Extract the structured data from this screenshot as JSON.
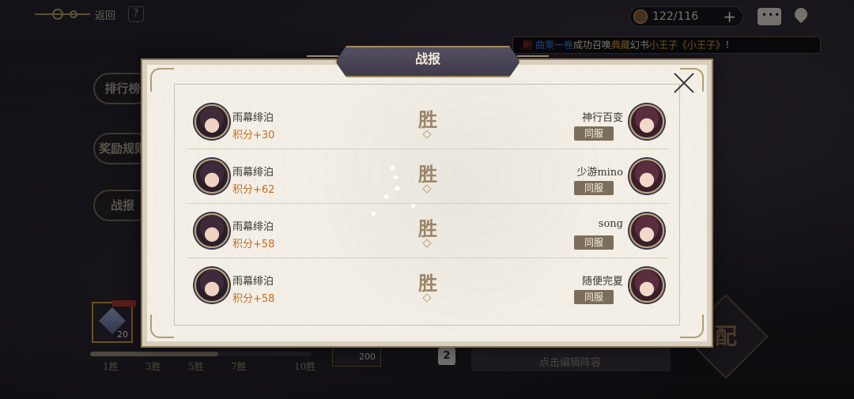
{
  "topbar": {
    "back_label": "返回",
    "help_label": "?",
    "stamina": "122/116",
    "plus_label": "+"
  },
  "marquee": {
    "seg1": "刷",
    "seg2": "曲栗一卷",
    "seg3": "成功召唤",
    "seg4": "典藏",
    "seg5": "幻书",
    "seg6": "小王子《小王子》",
    "seg7": "！"
  },
  "side": {
    "rank": "排行榜",
    "rules": "奖励规则",
    "report": "战报"
  },
  "bottom": {
    "reward_count": "20",
    "progress": 0.58,
    "milestones": [
      "1胜",
      "3胜",
      "5胜",
      "7胜",
      "10胜"
    ],
    "coin": "200",
    "chip": "2",
    "team_hint": "点击编辑阵容",
    "match_label": "配"
  },
  "modal": {
    "title": "战报",
    "rows": [
      {
        "player": "雨幕绯泊",
        "score": "积分+30",
        "result": "胜",
        "opponent": "神行百变",
        "badge": "同服"
      },
      {
        "player": "雨幕绯泊",
        "score": "积分+62",
        "result": "胜",
        "opponent": "少游mino",
        "badge": "同服"
      },
      {
        "player": "雨幕绯泊",
        "score": "积分+58",
        "result": "胜",
        "opponent": "song",
        "badge": "同服"
      },
      {
        "player": "雨幕绯泊",
        "score": "积分+58",
        "result": "胜",
        "opponent": "随便完夏",
        "badge": "同服"
      }
    ]
  },
  "icons": {
    "close": "close-icon",
    "chat": "chat-icon",
    "location": "location-pin-icon",
    "help": "help-icon"
  }
}
